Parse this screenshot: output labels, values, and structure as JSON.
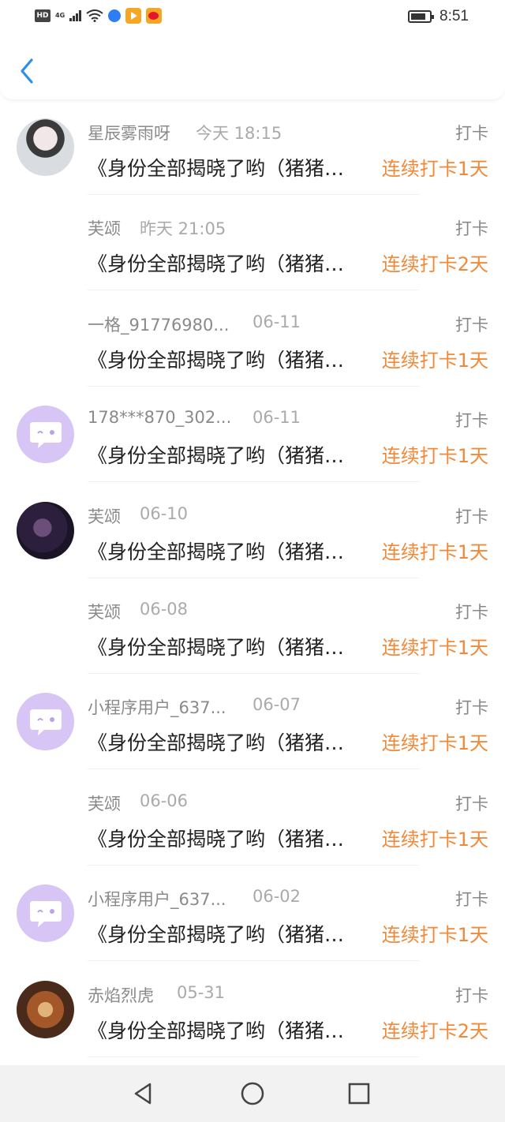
{
  "status_bar": {
    "hd": "HD",
    "network": "4G",
    "time": "8:51"
  },
  "header": {
    "back_icon": "chevron-left-icon",
    "accent": "#2e8fe8"
  },
  "colors": {
    "streak": "#f08a3a",
    "name": "#8a8a8a",
    "avatar_placeholder": "#d6c5f5"
  },
  "items": [
    {
      "name": "星辰雾雨呀",
      "date": "今天 18:15",
      "tag": "打卡",
      "content": "《身份全部揭晓了哟（猪猪…",
      "streak": "连续打卡1天",
      "avatar": "photo"
    },
    {
      "name": "芙颂",
      "date": "昨天 21:05",
      "tag": "打卡",
      "content": "《身份全部揭晓了哟（猪猪…",
      "streak": "连续打卡2天",
      "avatar": "none"
    },
    {
      "name": "一格_91776980...",
      "date": "06-11",
      "tag": "打卡",
      "content": "《身份全部揭晓了哟（猪猪…",
      "streak": "连续打卡1天",
      "avatar": "none"
    },
    {
      "name": "178***870_302...",
      "date": "06-11",
      "tag": "打卡",
      "content": "《身份全部揭晓了哟（猪猪…",
      "streak": "连续打卡1天",
      "avatar": "placeholder"
    },
    {
      "name": "芙颂",
      "date": "06-10",
      "tag": "打卡",
      "content": "《身份全部揭晓了哟（猪猪…",
      "streak": "连续打卡1天",
      "avatar": "photo"
    },
    {
      "name": "芙颂",
      "date": "06-08",
      "tag": "打卡",
      "content": "《身份全部揭晓了哟（猪猪…",
      "streak": "连续打卡1天",
      "avatar": "none"
    },
    {
      "name": "小程序用户_637...",
      "date": "06-07",
      "tag": "打卡",
      "content": "《身份全部揭晓了哟（猪猪…",
      "streak": "连续打卡1天",
      "avatar": "placeholder"
    },
    {
      "name": "芙颂",
      "date": "06-06",
      "tag": "打卡",
      "content": "《身份全部揭晓了哟（猪猪…",
      "streak": "连续打卡1天",
      "avatar": "none"
    },
    {
      "name": "小程序用户_637...",
      "date": "06-02",
      "tag": "打卡",
      "content": "《身份全部揭晓了哟（猪猪…",
      "streak": "连续打卡1天",
      "avatar": "placeholder"
    },
    {
      "name": "赤焰烈虎",
      "date": "05-31",
      "tag": "打卡",
      "content": "《身份全部揭晓了哟（猪猪…",
      "streak": "连续打卡2天",
      "avatar": "photo"
    }
  ],
  "nav": {
    "back_icon": "triangle-back-icon",
    "home_icon": "circle-home-icon",
    "recents_icon": "square-recents-icon"
  }
}
